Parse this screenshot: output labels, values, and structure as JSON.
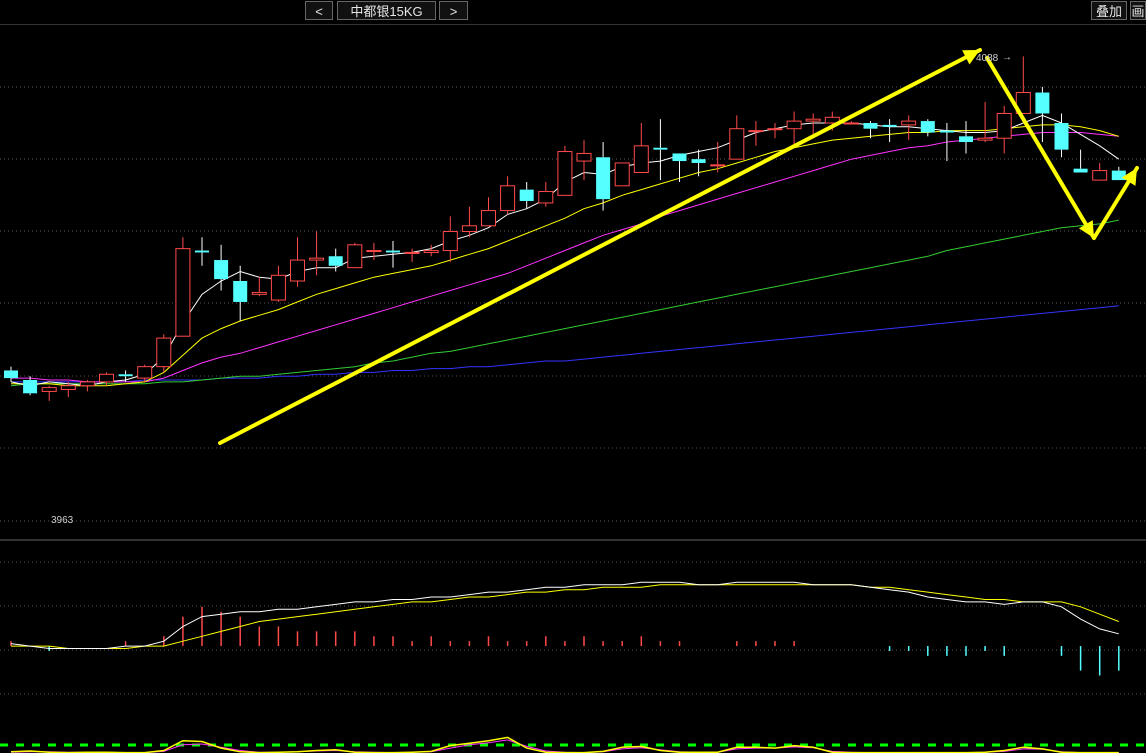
{
  "toolbar": {
    "prev_label": "<",
    "title": "中都银15KG",
    "next_label": ">",
    "overlay_label": "叠加",
    "draw_label": "画"
  },
  "colors": {
    "up": "#ff4a4a",
    "down": "#54ffff",
    "ma5": "#ffffff",
    "ma10": "#ffff00",
    "ma20": "#ff33ff",
    "ma60": "#33cc33",
    "ma120": "#3333ff",
    "annotation": "#ffff00",
    "grid": "#555555",
    "signal": "#00ff00"
  },
  "chart_data": {
    "type": "candlestick",
    "title": "",
    "xlabel": "",
    "ylabel": "",
    "ylim": [
      3888,
      4158
    ],
    "grid": true,
    "annotations": {
      "low_label": "3963",
      "high_label": "4088",
      "low_value": 3963,
      "high_value": 4088,
      "high_arrow": "→"
    },
    "candles": [
      [
        3976,
        3972,
        3978,
        3970
      ],
      [
        3971,
        3964,
        3973,
        3963
      ],
      [
        3965,
        3967,
        3968,
        3960
      ],
      [
        3966,
        3968,
        3970,
        3962
      ],
      [
        3968,
        3970,
        3971,
        3965
      ],
      [
        3970,
        3974,
        3975,
        3968
      ],
      [
        3974,
        3973,
        3976,
        3970
      ],
      [
        3972,
        3978,
        3979,
        3970
      ],
      [
        3978,
        3993,
        3995,
        3975
      ],
      [
        3994,
        4040,
        4046,
        3994
      ],
      [
        4039,
        4038,
        4046,
        4031
      ],
      [
        4034,
        4024,
        4042,
        4018
      ],
      [
        4023,
        4012,
        4031,
        4002
      ],
      [
        4016,
        4017,
        4025,
        4015
      ],
      [
        4013,
        4026,
        4031,
        4012
      ],
      [
        4023,
        4034,
        4046,
        4020
      ],
      [
        4034,
        4035,
        4049,
        4026
      ],
      [
        4036,
        4031,
        4040,
        4028
      ],
      [
        4030,
        4042,
        4043,
        4030
      ],
      [
        4039,
        4039,
        4043,
        4034
      ],
      [
        4039,
        4038,
        4044,
        4030
      ],
      [
        4038,
        4038,
        4040,
        4033
      ],
      [
        4038,
        4039,
        4042,
        4036
      ],
      [
        4039,
        4049,
        4057,
        4033
      ],
      [
        4049,
        4052,
        4062,
        4046
      ],
      [
        4052,
        4060,
        4067,
        4054
      ],
      [
        4060,
        4073,
        4078,
        4058
      ],
      [
        4071,
        4065,
        4075,
        4061
      ],
      [
        4064,
        4070,
        4075,
        4062
      ],
      [
        4068,
        4091,
        4094,
        4068
      ],
      [
        4086,
        4090,
        4097,
        4076
      ],
      [
        4088,
        4066,
        4096,
        4060
      ],
      [
        4073,
        4085,
        4085,
        4073
      ],
      [
        4080,
        4094,
        4106,
        4080
      ],
      [
        4093,
        4092,
        4108,
        4076
      ],
      [
        4090,
        4086,
        4090,
        4075
      ],
      [
        4087,
        4085,
        4092,
        4078
      ],
      [
        4084,
        4084,
        4096,
        4080
      ],
      [
        4087,
        4103,
        4110,
        4087
      ],
      [
        4102,
        4102,
        4107,
        4094
      ],
      [
        4103,
        4103,
        4106,
        4098
      ],
      [
        4103,
        4107,
        4112,
        4094
      ],
      [
        4107,
        4108,
        4111,
        4099
      ],
      [
        4106,
        4109,
        4112,
        4102
      ],
      [
        4106,
        4106,
        4107,
        4106
      ],
      [
        4106,
        4103,
        4107,
        4098
      ],
      [
        4105,
        4104,
        4108,
        4096
      ],
      [
        4105,
        4107,
        4110,
        4097
      ],
      [
        4107,
        4101,
        4108,
        4099
      ],
      [
        4102,
        4101,
        4106,
        4086
      ],
      [
        4099,
        4096,
        4107,
        4090
      ],
      [
        4097,
        4098,
        4117,
        4096
      ],
      [
        4098,
        4111,
        4115,
        4090
      ],
      [
        4111,
        4122,
        4141,
        4111
      ],
      [
        4122,
        4111,
        4125,
        4096
      ],
      [
        4106,
        4092,
        4111,
        4088
      ],
      [
        4082,
        4080,
        4092,
        4080
      ],
      [
        4076,
        4081,
        4085,
        4076
      ],
      [
        4081,
        4076,
        4083,
        4076
      ]
    ],
    "indicators": {
      "ma5": [
        3970,
        3968,
        3970,
        3969,
        3968,
        3970,
        3971,
        3974,
        3983,
        4001,
        4016,
        4023,
        4028,
        4025,
        4024,
        4028,
        4030,
        4030,
        4035,
        4036,
        4037,
        4038,
        4040,
        4044,
        4047,
        4051,
        4058,
        4061,
        4066,
        4075,
        4080,
        4079,
        4083,
        4085,
        4086,
        4089,
        4091,
        4093,
        4097,
        4101,
        4103,
        4105,
        4106,
        4106,
        4106,
        4105,
        4104,
        4104,
        4103,
        4102,
        4101,
        4101,
        4102,
        4106,
        4110,
        4106,
        4100,
        4094,
        4087
      ],
      "ma10": [
        3969,
        3969,
        3969,
        3968,
        3968,
        3968,
        3969,
        3970,
        3975,
        3984,
        3993,
        3998,
        4002,
        4005,
        4008,
        4012,
        4016,
        4019,
        4022,
        4025,
        4027,
        4029,
        4031,
        4034,
        4037,
        4040,
        4044,
        4048,
        4052,
        4056,
        4061,
        4064,
        4068,
        4071,
        4074,
        4077,
        4080,
        4082,
        4085,
        4088,
        4091,
        4093,
        4095,
        4097,
        4098,
        4099,
        4100,
        4101,
        4101,
        4102,
        4102,
        4102,
        4103,
        4104,
        4105,
        4105,
        4104,
        4102,
        4099
      ],
      "ma20": [
        3972,
        3972,
        3971,
        3971,
        3970,
        3970,
        3970,
        3970,
        3972,
        3976,
        3980,
        3983,
        3985,
        3988,
        3991,
        3994,
        3997,
        4000,
        4003,
        4006,
        4009,
        4012,
        4015,
        4018,
        4021,
        4024,
        4027,
        4031,
        4035,
        4039,
        4043,
        4047,
        4050,
        4053,
        4057,
        4060,
        4063,
        4066,
        4069,
        4072,
        4075,
        4078,
        4081,
        4084,
        4087,
        4089,
        4091,
        4093,
        4094,
        4096,
        4097,
        4098,
        4099,
        4100,
        4101,
        4101,
        4101,
        4100,
        4099
      ],
      "ma60": [
        3968,
        3969,
        3969,
        3969,
        3969,
        3969,
        3969,
        3969,
        3970,
        3970,
        3971,
        3972,
        3973,
        3973,
        3974,
        3975,
        3976,
        3977,
        3978,
        3980,
        3981,
        3983,
        3985,
        3986,
        3988,
        3990,
        3992,
        3994,
        3996,
        3998,
        4000,
        4002,
        4004,
        4006,
        4008,
        4010,
        4012,
        4014,
        4016,
        4018,
        4020,
        4022,
        4024,
        4026,
        4028,
        4030,
        4032,
        4034,
        4036,
        4039,
        4041,
        4043,
        4045,
        4047,
        4049,
        4051,
        4052,
        4053,
        4055
      ],
      "ma120": [
        3970,
        3970,
        3970,
        3970,
        3970,
        3970,
        3970,
        3971,
        3971,
        3971,
        3971,
        3972,
        3972,
        3972,
        3973,
        3973,
        3974,
        3974,
        3975,
        3975,
        3976,
        3976,
        3977,
        3977,
        3978,
        3978,
        3979,
        3980,
        3981,
        3981,
        3982,
        3983,
        3984,
        3985,
        3986,
        3987,
        3988,
        3989,
        3990,
        3991,
        3992,
        3993,
        3994,
        3995,
        3996,
        3997,
        3998,
        3999,
        4000,
        4001,
        4002,
        4003,
        4004,
        4005,
        4006,
        4007,
        4008,
        4009,
        4010
      ]
    },
    "macd": {
      "ylim": [
        -22,
        40
      ],
      "dif": [
        1,
        0,
        -1,
        -1,
        -1,
        -1,
        0,
        0,
        2,
        8,
        12,
        13,
        14,
        14,
        15,
        15,
        16,
        17,
        18,
        18,
        19,
        19,
        20,
        20,
        21,
        22,
        22,
        23,
        24,
        24,
        25,
        25,
        25,
        26,
        26,
        26,
        25,
        25,
        26,
        26,
        26,
        26,
        25,
        25,
        25,
        24,
        23,
        22,
        20,
        19,
        18,
        18,
        17,
        18,
        18,
        16,
        11,
        7,
        5
      ],
      "dea": [
        0,
        0,
        0,
        -1,
        -1,
        -1,
        -1,
        0,
        0,
        2,
        4,
        6,
        8,
        10,
        11,
        12,
        13,
        14,
        15,
        16,
        17,
        18,
        18,
        19,
        20,
        20,
        21,
        22,
        22,
        23,
        23,
        24,
        24,
        24,
        25,
        25,
        25,
        25,
        25,
        25,
        25,
        25,
        25,
        25,
        25,
        24,
        24,
        23,
        22,
        21,
        20,
        19,
        19,
        18,
        18,
        18,
        16,
        13,
        10
      ]
    },
    "kdj": {
      "ylim": [
        0,
        100
      ],
      "k": [
        3,
        5,
        2,
        1,
        2,
        2,
        1,
        1,
        6,
        30,
        28,
        12,
        3,
        1,
        2,
        3,
        6,
        8,
        2,
        1,
        1,
        2,
        4,
        18,
        24,
        30,
        38,
        12,
        2,
        1,
        1,
        4,
        14,
        16,
        6,
        2,
        2,
        2,
        14,
        14,
        12,
        18,
        14,
        2,
        1,
        1,
        1,
        1,
        1,
        1,
        1,
        2,
        6,
        14,
        10,
        2,
        1,
        1,
        1
      ],
      "d": [
        2,
        3,
        3,
        2,
        2,
        2,
        1,
        1,
        4,
        20,
        22,
        14,
        6,
        2,
        2,
        3,
        5,
        6,
        3,
        2,
        1,
        2,
        3,
        12,
        20,
        25,
        32,
        16,
        5,
        2,
        1,
        3,
        10,
        13,
        8,
        3,
        2,
        2,
        10,
        12,
        12,
        15,
        13,
        4,
        2,
        1,
        1,
        1,
        1,
        1,
        1,
        2,
        4,
        10,
        9,
        3,
        1,
        1,
        1
      ]
    }
  }
}
